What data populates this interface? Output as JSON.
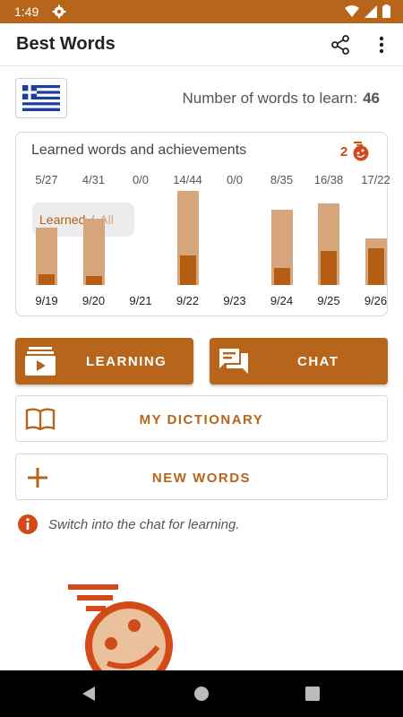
{
  "status_bar": {
    "time": "1:49"
  },
  "app_bar": {
    "title": "Best Words"
  },
  "language": {
    "flag": "greece-flag"
  },
  "words_to_learn": {
    "label": "Number of words to learn:",
    "count": "46"
  },
  "stats_card": {
    "title": "Learned words and achievements",
    "achievements_count": "2",
    "legend": {
      "learned": "Learned",
      "separator": "/",
      "all": "All"
    }
  },
  "chart_data": {
    "type": "bar",
    "categories": [
      "9/19",
      "9/20",
      "9/21",
      "9/22",
      "9/23",
      "9/24",
      "9/25",
      "9/26"
    ],
    "ratio_labels": [
      "5/27",
      "4/31",
      "0/0",
      "14/44",
      "0/0",
      "8/35",
      "16/38",
      "17/22"
    ],
    "series": [
      {
        "name": "Learned",
        "values": [
          5,
          4,
          0,
          14,
          0,
          8,
          16,
          17
        ]
      },
      {
        "name": "All",
        "values": [
          27,
          31,
          0,
          44,
          0,
          35,
          38,
          22
        ]
      }
    ],
    "colors": {
      "learned": "#b55d12",
      "all": "#d7a57c"
    },
    "ylim": [
      0,
      44
    ]
  },
  "buttons": {
    "learning": "LEARNING",
    "chat": "CHAT",
    "dictionary": "MY DICTIONARY",
    "new_words": "NEW WORDS"
  },
  "info": {
    "text": "Switch into the chat for learning."
  },
  "colors": {
    "accent": "#b8651c",
    "status_bar": "#b8651c",
    "badge": "#d04a1a"
  }
}
